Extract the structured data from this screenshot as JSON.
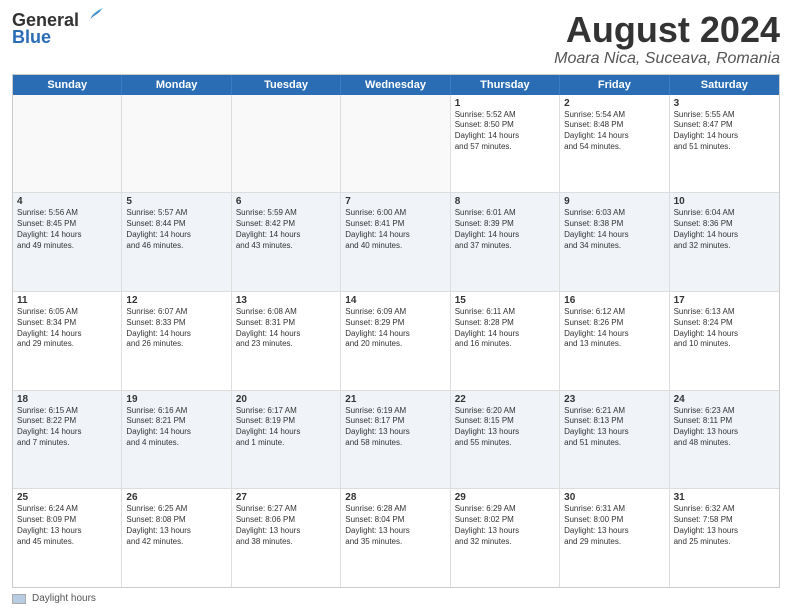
{
  "header": {
    "logo_general": "General",
    "logo_blue": "Blue",
    "main_title": "August 2024",
    "subtitle": "Moara Nica, Suceava, Romania"
  },
  "days_of_week": [
    "Sunday",
    "Monday",
    "Tuesday",
    "Wednesday",
    "Thursday",
    "Friday",
    "Saturday"
  ],
  "footer": {
    "legend_label": "Daylight hours"
  },
  "weeks": [
    [
      {
        "day": "",
        "empty": true
      },
      {
        "day": "",
        "empty": true
      },
      {
        "day": "",
        "empty": true
      },
      {
        "day": "",
        "empty": true
      },
      {
        "day": "1",
        "lines": [
          "Sunrise: 5:52 AM",
          "Sunset: 8:50 PM",
          "Daylight: 14 hours",
          "and 57 minutes."
        ]
      },
      {
        "day": "2",
        "lines": [
          "Sunrise: 5:54 AM",
          "Sunset: 8:48 PM",
          "Daylight: 14 hours",
          "and 54 minutes."
        ]
      },
      {
        "day": "3",
        "lines": [
          "Sunrise: 5:55 AM",
          "Sunset: 8:47 PM",
          "Daylight: 14 hours",
          "and 51 minutes."
        ]
      }
    ],
    [
      {
        "day": "4",
        "lines": [
          "Sunrise: 5:56 AM",
          "Sunset: 8:45 PM",
          "Daylight: 14 hours",
          "and 49 minutes."
        ]
      },
      {
        "day": "5",
        "lines": [
          "Sunrise: 5:57 AM",
          "Sunset: 8:44 PM",
          "Daylight: 14 hours",
          "and 46 minutes."
        ]
      },
      {
        "day": "6",
        "lines": [
          "Sunrise: 5:59 AM",
          "Sunset: 8:42 PM",
          "Daylight: 14 hours",
          "and 43 minutes."
        ]
      },
      {
        "day": "7",
        "lines": [
          "Sunrise: 6:00 AM",
          "Sunset: 8:41 PM",
          "Daylight: 14 hours",
          "and 40 minutes."
        ]
      },
      {
        "day": "8",
        "lines": [
          "Sunrise: 6:01 AM",
          "Sunset: 8:39 PM",
          "Daylight: 14 hours",
          "and 37 minutes."
        ]
      },
      {
        "day": "9",
        "lines": [
          "Sunrise: 6:03 AM",
          "Sunset: 8:38 PM",
          "Daylight: 14 hours",
          "and 34 minutes."
        ]
      },
      {
        "day": "10",
        "lines": [
          "Sunrise: 6:04 AM",
          "Sunset: 8:36 PM",
          "Daylight: 14 hours",
          "and 32 minutes."
        ]
      }
    ],
    [
      {
        "day": "11",
        "lines": [
          "Sunrise: 6:05 AM",
          "Sunset: 8:34 PM",
          "Daylight: 14 hours",
          "and 29 minutes."
        ]
      },
      {
        "day": "12",
        "lines": [
          "Sunrise: 6:07 AM",
          "Sunset: 8:33 PM",
          "Daylight: 14 hours",
          "and 26 minutes."
        ]
      },
      {
        "day": "13",
        "lines": [
          "Sunrise: 6:08 AM",
          "Sunset: 8:31 PM",
          "Daylight: 14 hours",
          "and 23 minutes."
        ]
      },
      {
        "day": "14",
        "lines": [
          "Sunrise: 6:09 AM",
          "Sunset: 8:29 PM",
          "Daylight: 14 hours",
          "and 20 minutes."
        ]
      },
      {
        "day": "15",
        "lines": [
          "Sunrise: 6:11 AM",
          "Sunset: 8:28 PM",
          "Daylight: 14 hours",
          "and 16 minutes."
        ]
      },
      {
        "day": "16",
        "lines": [
          "Sunrise: 6:12 AM",
          "Sunset: 8:26 PM",
          "Daylight: 14 hours",
          "and 13 minutes."
        ]
      },
      {
        "day": "17",
        "lines": [
          "Sunrise: 6:13 AM",
          "Sunset: 8:24 PM",
          "Daylight: 14 hours",
          "and 10 minutes."
        ]
      }
    ],
    [
      {
        "day": "18",
        "lines": [
          "Sunrise: 6:15 AM",
          "Sunset: 8:22 PM",
          "Daylight: 14 hours",
          "and 7 minutes."
        ]
      },
      {
        "day": "19",
        "lines": [
          "Sunrise: 6:16 AM",
          "Sunset: 8:21 PM",
          "Daylight: 14 hours",
          "and 4 minutes."
        ]
      },
      {
        "day": "20",
        "lines": [
          "Sunrise: 6:17 AM",
          "Sunset: 8:19 PM",
          "Daylight: 14 hours",
          "and 1 minute."
        ]
      },
      {
        "day": "21",
        "lines": [
          "Sunrise: 6:19 AM",
          "Sunset: 8:17 PM",
          "Daylight: 13 hours",
          "and 58 minutes."
        ]
      },
      {
        "day": "22",
        "lines": [
          "Sunrise: 6:20 AM",
          "Sunset: 8:15 PM",
          "Daylight: 13 hours",
          "and 55 minutes."
        ]
      },
      {
        "day": "23",
        "lines": [
          "Sunrise: 6:21 AM",
          "Sunset: 8:13 PM",
          "Daylight: 13 hours",
          "and 51 minutes."
        ]
      },
      {
        "day": "24",
        "lines": [
          "Sunrise: 6:23 AM",
          "Sunset: 8:11 PM",
          "Daylight: 13 hours",
          "and 48 minutes."
        ]
      }
    ],
    [
      {
        "day": "25",
        "lines": [
          "Sunrise: 6:24 AM",
          "Sunset: 8:09 PM",
          "Daylight: 13 hours",
          "and 45 minutes."
        ]
      },
      {
        "day": "26",
        "lines": [
          "Sunrise: 6:25 AM",
          "Sunset: 8:08 PM",
          "Daylight: 13 hours",
          "and 42 minutes."
        ]
      },
      {
        "day": "27",
        "lines": [
          "Sunrise: 6:27 AM",
          "Sunset: 8:06 PM",
          "Daylight: 13 hours",
          "and 38 minutes."
        ]
      },
      {
        "day": "28",
        "lines": [
          "Sunrise: 6:28 AM",
          "Sunset: 8:04 PM",
          "Daylight: 13 hours",
          "and 35 minutes."
        ]
      },
      {
        "day": "29",
        "lines": [
          "Sunrise: 6:29 AM",
          "Sunset: 8:02 PM",
          "Daylight: 13 hours",
          "and 32 minutes."
        ]
      },
      {
        "day": "30",
        "lines": [
          "Sunrise: 6:31 AM",
          "Sunset: 8:00 PM",
          "Daylight: 13 hours",
          "and 29 minutes."
        ]
      },
      {
        "day": "31",
        "lines": [
          "Sunrise: 6:32 AM",
          "Sunset: 7:58 PM",
          "Daylight: 13 hours",
          "and 25 minutes."
        ]
      }
    ]
  ]
}
